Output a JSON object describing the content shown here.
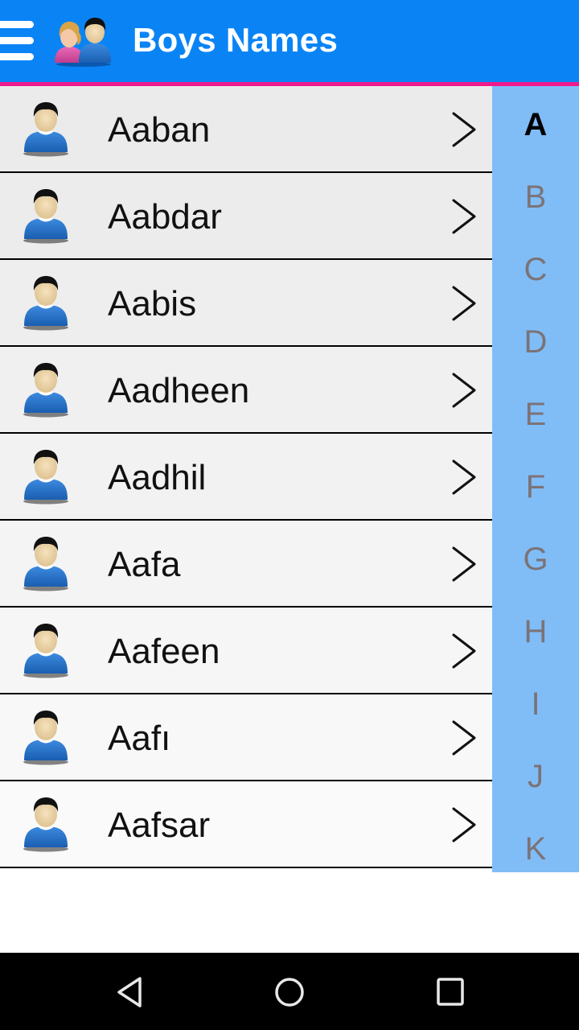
{
  "app_bar": {
    "title": "Boys Names",
    "menu_icon": "hamburger-menu-icon",
    "logo_icon": "boy-girl-people-icon",
    "background_color": "#0a84f5",
    "accent_border_color": "#f0198c"
  },
  "names": [
    {
      "name": "Aaban"
    },
    {
      "name": "Aabdar"
    },
    {
      "name": "Aabis"
    },
    {
      "name": "Aadheen"
    },
    {
      "name": "Aadhil"
    },
    {
      "name": "Aafa"
    },
    {
      "name": "Aafeen"
    },
    {
      "name": "Aafı"
    },
    {
      "name": "Aafsar"
    }
  ],
  "row_icons": {
    "avatar": "boy-avatar-icon",
    "chevron": "chevron-right-icon"
  },
  "index_bar": {
    "letters": [
      "A",
      "B",
      "C",
      "D",
      "E",
      "F",
      "G",
      "H",
      "I",
      "J",
      "K"
    ],
    "active": "A",
    "background_color": "#80bdf7"
  },
  "nav_bar": {
    "back": "back-icon",
    "home": "home-icon",
    "recents": "recents-icon"
  }
}
